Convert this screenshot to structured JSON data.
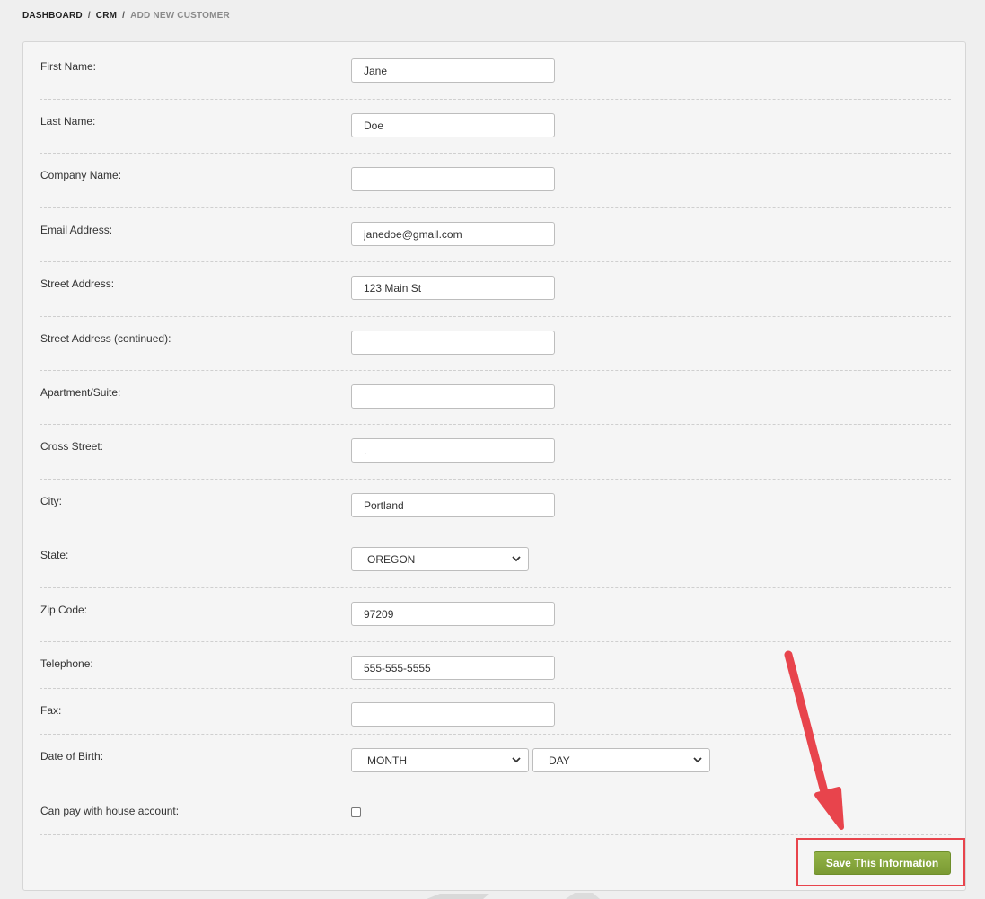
{
  "breadcrumb": {
    "items": [
      "DASHBOARD",
      "CRM",
      "ADD NEW CUSTOMER"
    ],
    "separator": "/"
  },
  "form": {
    "first_name": {
      "label": "First Name:",
      "value": "Jane"
    },
    "last_name": {
      "label": "Last Name:",
      "value": "Doe"
    },
    "company_name": {
      "label": "Company Name:",
      "value": ""
    },
    "email_address": {
      "label": "Email Address:",
      "value": "janedoe@gmail.com"
    },
    "street_address": {
      "label": "Street Address:",
      "value": "123 Main St"
    },
    "street_address_continued": {
      "label": "Street Address (continued):",
      "value": ""
    },
    "apartment_suite": {
      "label": "Apartment/Suite:",
      "value": ""
    },
    "cross_street": {
      "label": "Cross Street:",
      "value": "."
    },
    "city": {
      "label": "City:",
      "value": "Portland"
    },
    "state": {
      "label": "State:",
      "selected": "OREGON"
    },
    "zip_code": {
      "label": "Zip Code:",
      "value": "97209"
    },
    "telephone": {
      "label": "Telephone:",
      "value": "555-555-5555"
    },
    "fax": {
      "label": "Fax:",
      "value": ""
    },
    "date_of_birth": {
      "label": "Date of Birth:",
      "month": "MONTH",
      "day": "DAY"
    },
    "house_account": {
      "label": "Can pay with house account:",
      "checked": false
    }
  },
  "actions": {
    "save_label": "Save This Information"
  },
  "colors": {
    "save_button": "#86a53c",
    "annotation": "#e8444c"
  },
  "icons": {
    "select_arrow": "chevron-down-icon",
    "annotation_arrow": "arrow-icon"
  }
}
